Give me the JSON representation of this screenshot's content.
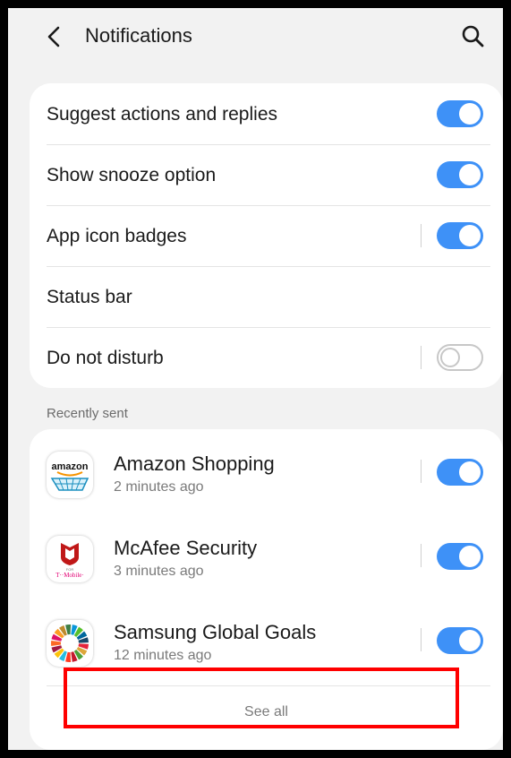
{
  "header": {
    "title": "Notifications"
  },
  "settings": [
    {
      "label": "Suggest actions and replies",
      "toggle": "on",
      "separator": false
    },
    {
      "label": "Show snooze option",
      "toggle": "on",
      "separator": false
    },
    {
      "label": "App icon badges",
      "toggle": "on",
      "separator": true
    },
    {
      "label": "Status bar",
      "toggle": "none",
      "separator": false
    },
    {
      "label": "Do not disturb",
      "toggle": "off",
      "separator": true
    }
  ],
  "recent": {
    "title": "Recently sent",
    "apps": [
      {
        "name": "Amazon Shopping",
        "time": "2 minutes ago",
        "icon": "amazon-icon",
        "icon_text": "amazon",
        "toggle": "on"
      },
      {
        "name": "McAfee Security",
        "time": "3 minutes ago",
        "icon": "mcafee-icon",
        "icon_text": "T··Mobile·",
        "icon_subtext": "FOR",
        "toggle": "on"
      },
      {
        "name": "Samsung Global Goals",
        "time": "12 minutes ago",
        "icon": "global-goals-icon",
        "toggle": "on"
      }
    ],
    "see_all": "See all"
  },
  "colors": {
    "accent": "#3e91f7",
    "highlight": "#ff0000",
    "background": "#f2f2f2"
  }
}
